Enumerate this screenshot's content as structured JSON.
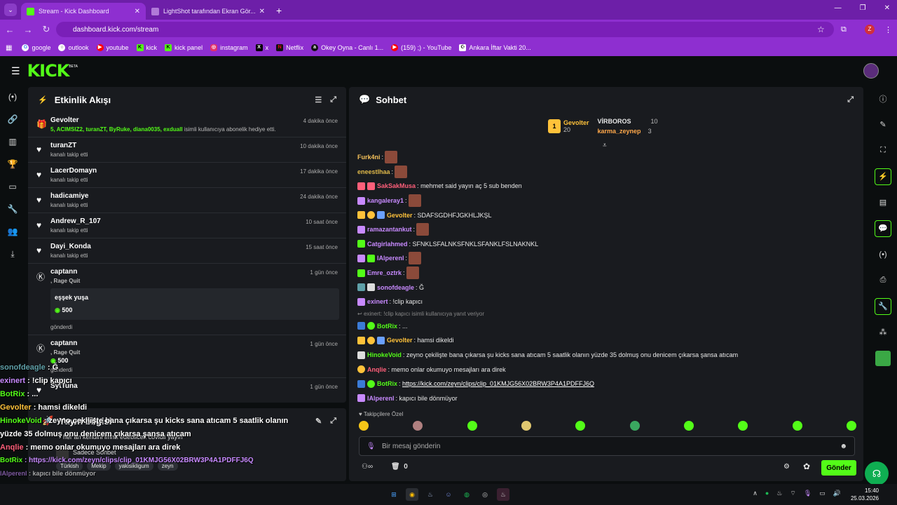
{
  "browser": {
    "tabs": [
      {
        "title": "Stream - Kick Dashboard"
      },
      {
        "title": "LightShot tarafından Ekran Gör..."
      }
    ],
    "url": "dashboard.kick.com/stream",
    "bookmarks": [
      "google",
      "outlook",
      "youtube",
      "kick",
      "kick panel",
      "instagram",
      "x",
      "Netflix",
      "Okey Oyna - Canlı 1...",
      "(159) ;) - YouTube",
      "Ankara İftar Vakti 20..."
    ]
  },
  "app": {
    "logo": "KICK",
    "logo_sup": "BETA"
  },
  "activity": {
    "title": "Etkinlik Akışı",
    "events": [
      {
        "name": "Gevolter",
        "time": "4 dakika önce",
        "sub_highlight": "5, ACIMSIZ2, turanZT, ByRuke, diana0035, exduall",
        "sub": " isimli kullanıcıya abonelik hediye etti."
      },
      {
        "name": "turanZT",
        "time": "10 dakika önce",
        "sub": "kanalı takip etti"
      },
      {
        "name": "LacerDomayn",
        "time": "17 dakika önce",
        "sub": "kanalı takip etti"
      },
      {
        "name": "hadicamiye",
        "time": "24 dakika önce",
        "sub": "kanalı takip etti"
      },
      {
        "name": "Andrew_R_107",
        "time": "10 saat önce",
        "sub": "kanalı takip etti"
      },
      {
        "name": "Dayi_Konda",
        "time": "15 saat önce",
        "sub": "kanalı takip etti"
      }
    ],
    "quit1": {
      "name": "captann",
      "time": "1 gün önce",
      "tag": ", Rage Quit",
      "message": "eşşek yuşa",
      "amount": "500",
      "sent": "gönderdi"
    },
    "quit2": {
      "name": "captann",
      "time": "1 gün önce",
      "tag": ", Rage Quit",
      "amount": "500",
      "sent": "gönderdi"
    },
    "last": {
      "name": "SytTuna",
      "time": "1 gün önce"
    }
  },
  "stream_info": {
    "title": "Yayın bilgisi",
    "desc": "her an kendini imha edebilcek covidli yayın",
    "lang": "Sadece Sohbet",
    "tags": [
      "Türkish",
      "Mekip",
      "yakisikligum",
      "zeyn"
    ]
  },
  "chat": {
    "title": "Sohbet",
    "leaders": [
      {
        "rank": "1",
        "name": "Gevolter",
        "count": "20"
      },
      {
        "name": "VİRBOROS",
        "count": "10"
      },
      {
        "name": "karma_zeynep",
        "count": "3"
      }
    ],
    "messages": [
      {
        "user": "Furk4ni",
        "color": "#f5c15a",
        "text": "",
        "emote": true
      },
      {
        "user": "eneestlhaa",
        "color": "#e0b94a",
        "text": "",
        "emote": true
      },
      {
        "user": "SakSakMusa",
        "color": "#ff5f7a",
        "text": "mehmet said yayın aç 5 sub benden"
      },
      {
        "user": "kangaleray1",
        "color": "#c88aff",
        "text": "",
        "emote": true
      },
      {
        "user": "Gevolter",
        "color": "#ffc23a",
        "text": "SDAFSGDHFJGKHLJKŞL"
      },
      {
        "user": "ramazantankut",
        "color": "#c88aff",
        "text": "",
        "emote": true
      },
      {
        "user": "Catgirlahmed",
        "color": "#c88aff",
        "text": "SFNKLSFALNKSFNKLSFANKLFSLNAKNKL"
      },
      {
        "user": "lAlperenl",
        "color": "#c88aff",
        "text": "",
        "emote": true
      },
      {
        "user": "Emre_oztrk",
        "color": "#c88aff",
        "text": "",
        "emote": true
      },
      {
        "user": "sonofdeagle",
        "color": "#c88aff",
        "text": "Ğ"
      },
      {
        "user": "exinert",
        "color": "#c88aff",
        "text": "!clip kapıcı"
      },
      {
        "user": "",
        "color": "#888",
        "text": "exinert: !clip kapıcı isimli kullanıcıya yanıt veriyor",
        "reply": true
      },
      {
        "user": "BotRix",
        "color": "#53fc18",
        "text": "..."
      },
      {
        "user": "Gevolter",
        "color": "#ffc23a",
        "text": "hamsi dikeldi"
      },
      {
        "user": "HinokeVoid",
        "color": "#53fc18",
        "text": "zeyno çekilişte bana çıkarsa şu kicks sana atıcam 5 saatlik olanın yüzde 35 dolmuş onu denicem çıkarsa şansa atıcam"
      },
      {
        "user": "Anqlie",
        "color": "#ff5f7a",
        "text": "memo onlar okumuyo mesajları ara direk"
      },
      {
        "user": "BotRix",
        "color": "#53fc18",
        "text": "https://kick.com/zeyn/clips/clip_01KMJG56X02BRW3P4A1PDFFJ6Q",
        "link": true
      },
      {
        "user": "lAlperenl",
        "color": "#c88aff",
        "text": "kapıcı bile dönmüyor"
      }
    ],
    "followers_label": "Takipçilere Özel",
    "input_placeholder": "Bir mesaj gönderin",
    "kick_count": "0",
    "send_label": "Gönder"
  },
  "overlay": [
    {
      "user": "sonofdeagle",
      "text": " : Ğ"
    },
    {
      "user": "exinert",
      "text": " : !clip kapıcı"
    },
    {
      "user": "BotRix",
      "text": " : ..."
    },
    {
      "user": "Gevolter",
      "text": " : hamsi dikeldi"
    },
    {
      "user": "HinokeVoid",
      "text": " : zeyno çekilişte bana çıkarsa şu kicks sana atıcam 5 saatlik olanın"
    },
    {
      "user": "",
      "text": "yüzde 35 dolmuş onu denicem çıkarsa şansa atıcam"
    },
    {
      "user": "Anqlie",
      "text": " : memo onlar okumuyo mesajları ara direk"
    },
    {
      "user": "BotRix",
      "text": " : https://kick.com/zeyn/clips/clip_01KMJG56X02BRW3P4A1PDFFJ6Q"
    },
    {
      "user": "lAlperenl",
      "text": " : kapıcı bile dönmüyor"
    }
  ],
  "clock": {
    "time": "15:40",
    "date": "25.03.2026"
  },
  "colors": {
    "accent": "#53fc18",
    "browser": "#8e2fd0"
  }
}
